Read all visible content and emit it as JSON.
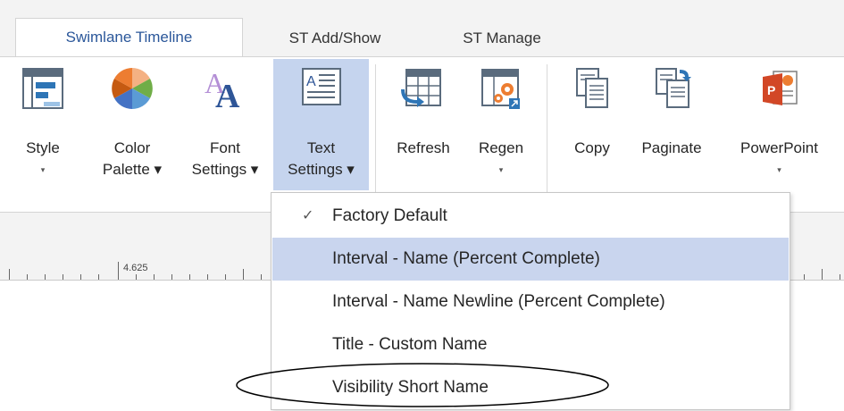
{
  "tabs": [
    {
      "label": "Swimlane Timeline",
      "active": true
    },
    {
      "label": "ST Add/Show",
      "active": false
    },
    {
      "label": "ST Manage",
      "active": false
    }
  ],
  "ribbon": {
    "style": {
      "line1": "Style",
      "line2": "▾",
      "icon": "gantt-style-icon"
    },
    "color_palette": {
      "line1": "Color",
      "line2": "Palette ▾",
      "icon": "color-wheel-icon"
    },
    "font_settings": {
      "line1": "Font",
      "line2": "Settings ▾",
      "icon": "font-icon"
    },
    "text_settings": {
      "line1": "Text",
      "line2": "Settings ▾",
      "icon": "text-box-icon"
    },
    "refresh": {
      "line1": "Refresh",
      "icon": "refresh-grid-icon"
    },
    "regen": {
      "line1": "Regen",
      "line2": "▾",
      "icon": "regen-gear-icon"
    },
    "copy": {
      "line1": "Copy",
      "icon": "copy-icon"
    },
    "paginate": {
      "line1": "Paginate",
      "icon": "paginate-icon"
    },
    "powerpoint": {
      "line1": "PowerPoint",
      "line2": "▾",
      "icon": "powerpoint-icon"
    }
  },
  "ruler": {
    "label": "4.625"
  },
  "menu": {
    "items": [
      {
        "label": "Factory Default",
        "checked": true
      },
      {
        "label": "Interval - Name (Percent Complete)",
        "highlighted": true
      },
      {
        "label": "Interval - Name Newline (Percent Complete)"
      },
      {
        "label": "Title - Custom Name"
      },
      {
        "label": "Visibility Short Name",
        "circled": true
      }
    ],
    "check_glyph": "✓"
  },
  "colors": {
    "accent": "#2b579a",
    "highlight": "#c9d5ee",
    "pressed": "#c5d4ee"
  }
}
